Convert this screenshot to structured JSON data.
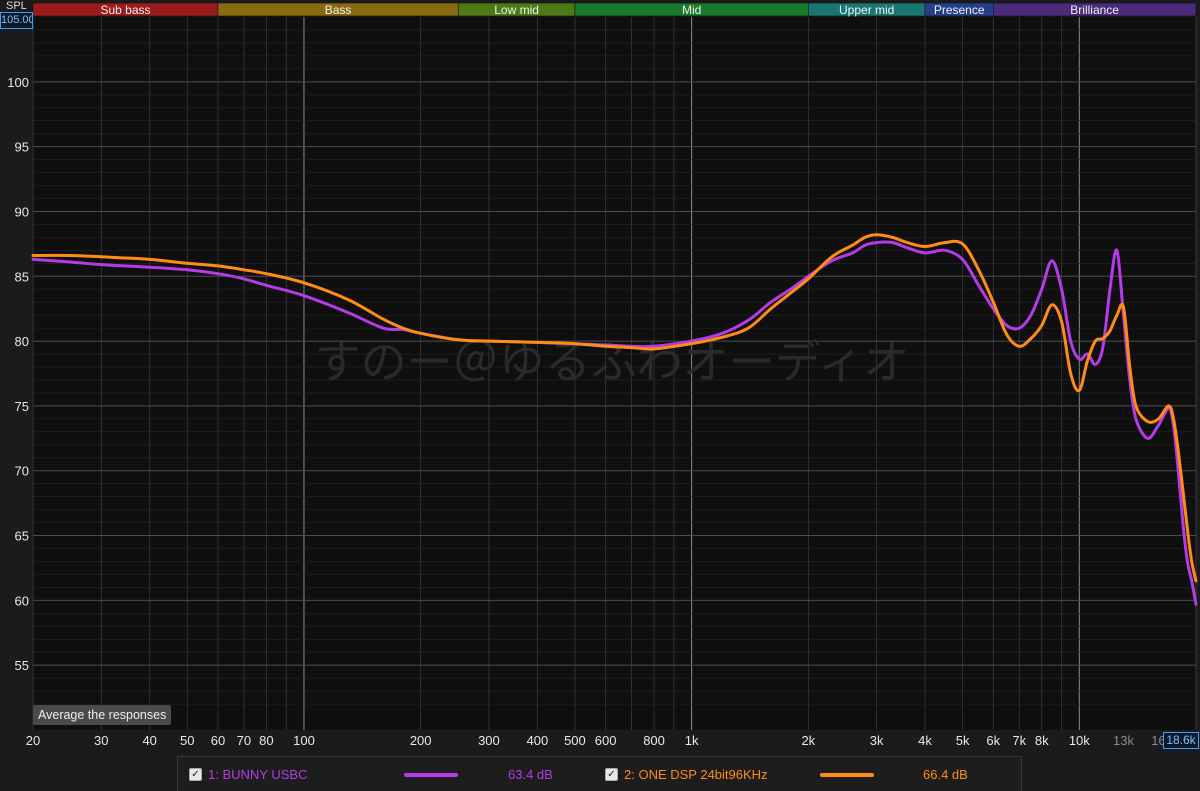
{
  "app": {
    "spl_label": "SPL",
    "y_max_value": "105.00",
    "x_max_value": "18.6k",
    "average_button": "Average the responses",
    "watermark": "すのー＠ゆるふわオーディオ"
  },
  "bands": [
    {
      "label": "Sub bass",
      "from": 20,
      "to": 60,
      "color": "#9b1c1c"
    },
    {
      "label": "Bass",
      "from": 60,
      "to": 250,
      "color": "#8a6a10"
    },
    {
      "label": "Low mid",
      "from": 250,
      "to": 500,
      "color": "#4e7a16"
    },
    {
      "label": "Mid",
      "from": 500,
      "to": 2000,
      "color": "#1a7a2c"
    },
    {
      "label": "Upper mid",
      "from": 2000,
      "to": 4000,
      "color": "#1a7670"
    },
    {
      "label": "Presence",
      "from": 4000,
      "to": 6000,
      "color": "#263f8a"
    },
    {
      "label": "Brilliance",
      "from": 6000,
      "to": 20000,
      "color": "#4a2a7a"
    }
  ],
  "legend": [
    {
      "checked": true,
      "label": "1: BUNNY USBC",
      "level": "63.4 dB",
      "color": "#b43ce6"
    },
    {
      "checked": true,
      "label": "2: ONE DSP 24bit96KHz",
      "level": "66.4 dB",
      "color": "#ff8c14"
    }
  ],
  "chart_data": {
    "type": "line",
    "xscale": "log",
    "xlim": [
      20,
      20000
    ],
    "ylim": [
      50,
      105
    ],
    "ylabel": "SPL",
    "grid": true,
    "y_ticks": [
      55,
      60,
      65,
      70,
      75,
      80,
      85,
      90,
      95,
      100
    ],
    "x_ticks": [
      {
        "v": 20,
        "label": "20"
      },
      {
        "v": 30,
        "label": "30"
      },
      {
        "v": 40,
        "label": "40"
      },
      {
        "v": 50,
        "label": "50"
      },
      {
        "v": 60,
        "label": "60"
      },
      {
        "v": 70,
        "label": "70"
      },
      {
        "v": 80,
        "label": "80"
      },
      {
        "v": 100,
        "label": "100"
      },
      {
        "v": 200,
        "label": "200"
      },
      {
        "v": 300,
        "label": "300"
      },
      {
        "v": 400,
        "label": "400"
      },
      {
        "v": 500,
        "label": "500"
      },
      {
        "v": 600,
        "label": "600"
      },
      {
        "v": 800,
        "label": "800"
      },
      {
        "v": 1000,
        "label": "1k"
      },
      {
        "v": 2000,
        "label": "2k"
      },
      {
        "v": 3000,
        "label": "3k"
      },
      {
        "v": 4000,
        "label": "4k"
      },
      {
        "v": 5000,
        "label": "5k"
      },
      {
        "v": 6000,
        "label": "6k"
      },
      {
        "v": 7000,
        "label": "7k"
      },
      {
        "v": 8000,
        "label": "8k"
      },
      {
        "v": 10000,
        "label": "10k"
      },
      {
        "v": 13000,
        "label": "13k",
        "dim": true
      },
      {
        "v": 16000,
        "label": "16",
        "dim": true
      }
    ],
    "series": [
      {
        "name": "1: BUNNY USBC",
        "color": "#b43ce6",
        "points": [
          [
            20,
            86.3
          ],
          [
            25,
            86.1
          ],
          [
            30,
            85.9
          ],
          [
            40,
            85.7
          ],
          [
            50,
            85.5
          ],
          [
            60,
            85.2
          ],
          [
            70,
            84.8
          ],
          [
            80,
            84.3
          ],
          [
            100,
            83.5
          ],
          [
            130,
            82.2
          ],
          [
            160,
            81.0
          ],
          [
            180,
            80.9
          ],
          [
            200,
            80.6
          ],
          [
            250,
            80.1
          ],
          [
            300,
            80.0
          ],
          [
            400,
            79.9
          ],
          [
            500,
            79.8
          ],
          [
            600,
            79.7
          ],
          [
            700,
            79.6
          ],
          [
            800,
            79.6
          ],
          [
            1000,
            80.0
          ],
          [
            1200,
            80.6
          ],
          [
            1400,
            81.6
          ],
          [
            1600,
            83.0
          ],
          [
            1800,
            84.0
          ],
          [
            2000,
            85.0
          ],
          [
            2300,
            86.2
          ],
          [
            2600,
            86.8
          ],
          [
            2800,
            87.4
          ],
          [
            3000,
            87.6
          ],
          [
            3300,
            87.6
          ],
          [
            3600,
            87.2
          ],
          [
            4000,
            86.8
          ],
          [
            4500,
            87.0
          ],
          [
            5000,
            86.3
          ],
          [
            5500,
            84.3
          ],
          [
            6000,
            82.5
          ],
          [
            6500,
            81.2
          ],
          [
            7000,
            81.0
          ],
          [
            7500,
            82.0
          ],
          [
            8000,
            84.0
          ],
          [
            8500,
            86.2
          ],
          [
            9000,
            84.0
          ],
          [
            9500,
            80.0
          ],
          [
            10000,
            78.6
          ],
          [
            10500,
            79.0
          ],
          [
            11000,
            78.2
          ],
          [
            11500,
            79.5
          ],
          [
            12000,
            84.0
          ],
          [
            12500,
            87.0
          ],
          [
            13000,
            82.0
          ],
          [
            13500,
            77.0
          ],
          [
            14000,
            74.0
          ],
          [
            15000,
            72.5
          ],
          [
            16000,
            73.5
          ],
          [
            17000,
            74.8
          ],
          [
            17500,
            73.5
          ],
          [
            18000,
            70.0
          ],
          [
            18500,
            66.0
          ],
          [
            19000,
            63.0
          ],
          [
            19500,
            61.5
          ],
          [
            20000,
            59.7
          ]
        ]
      },
      {
        "name": "2: ONE DSP 24bit96KHz",
        "color": "#ff8c14",
        "points": [
          [
            20,
            86.6
          ],
          [
            25,
            86.6
          ],
          [
            30,
            86.5
          ],
          [
            40,
            86.3
          ],
          [
            50,
            86.0
          ],
          [
            60,
            85.8
          ],
          [
            70,
            85.5
          ],
          [
            80,
            85.2
          ],
          [
            100,
            84.5
          ],
          [
            130,
            83.2
          ],
          [
            160,
            81.7
          ],
          [
            180,
            81.0
          ],
          [
            200,
            80.6
          ],
          [
            250,
            80.1
          ],
          [
            300,
            80.0
          ],
          [
            400,
            79.9
          ],
          [
            500,
            79.8
          ],
          [
            600,
            79.6
          ],
          [
            700,
            79.5
          ],
          [
            800,
            79.4
          ],
          [
            1000,
            79.8
          ],
          [
            1200,
            80.3
          ],
          [
            1400,
            81.0
          ],
          [
            1600,
            82.5
          ],
          [
            1800,
            83.7
          ],
          [
            2000,
            84.8
          ],
          [
            2300,
            86.5
          ],
          [
            2600,
            87.4
          ],
          [
            2800,
            88.0
          ],
          [
            3000,
            88.2
          ],
          [
            3300,
            88.0
          ],
          [
            3600,
            87.6
          ],
          [
            4000,
            87.3
          ],
          [
            4500,
            87.6
          ],
          [
            5000,
            87.5
          ],
          [
            5500,
            85.5
          ],
          [
            6000,
            83.0
          ],
          [
            6500,
            80.5
          ],
          [
            7000,
            79.6
          ],
          [
            7500,
            80.2
          ],
          [
            8000,
            81.2
          ],
          [
            8500,
            82.8
          ],
          [
            9000,
            81.5
          ],
          [
            9500,
            77.5
          ],
          [
            10000,
            76.2
          ],
          [
            10500,
            78.5
          ],
          [
            11000,
            80.0
          ],
          [
            11500,
            80.2
          ],
          [
            12000,
            80.8
          ],
          [
            12500,
            82.0
          ],
          [
            13000,
            82.6
          ],
          [
            13500,
            78.0
          ],
          [
            14000,
            75.0
          ],
          [
            15000,
            73.8
          ],
          [
            16000,
            74.0
          ],
          [
            17000,
            75.0
          ],
          [
            17500,
            74.0
          ],
          [
            18000,
            71.5
          ],
          [
            18500,
            68.5
          ],
          [
            19000,
            65.5
          ],
          [
            19500,
            63.0
          ],
          [
            20000,
            61.5
          ]
        ]
      }
    ]
  }
}
